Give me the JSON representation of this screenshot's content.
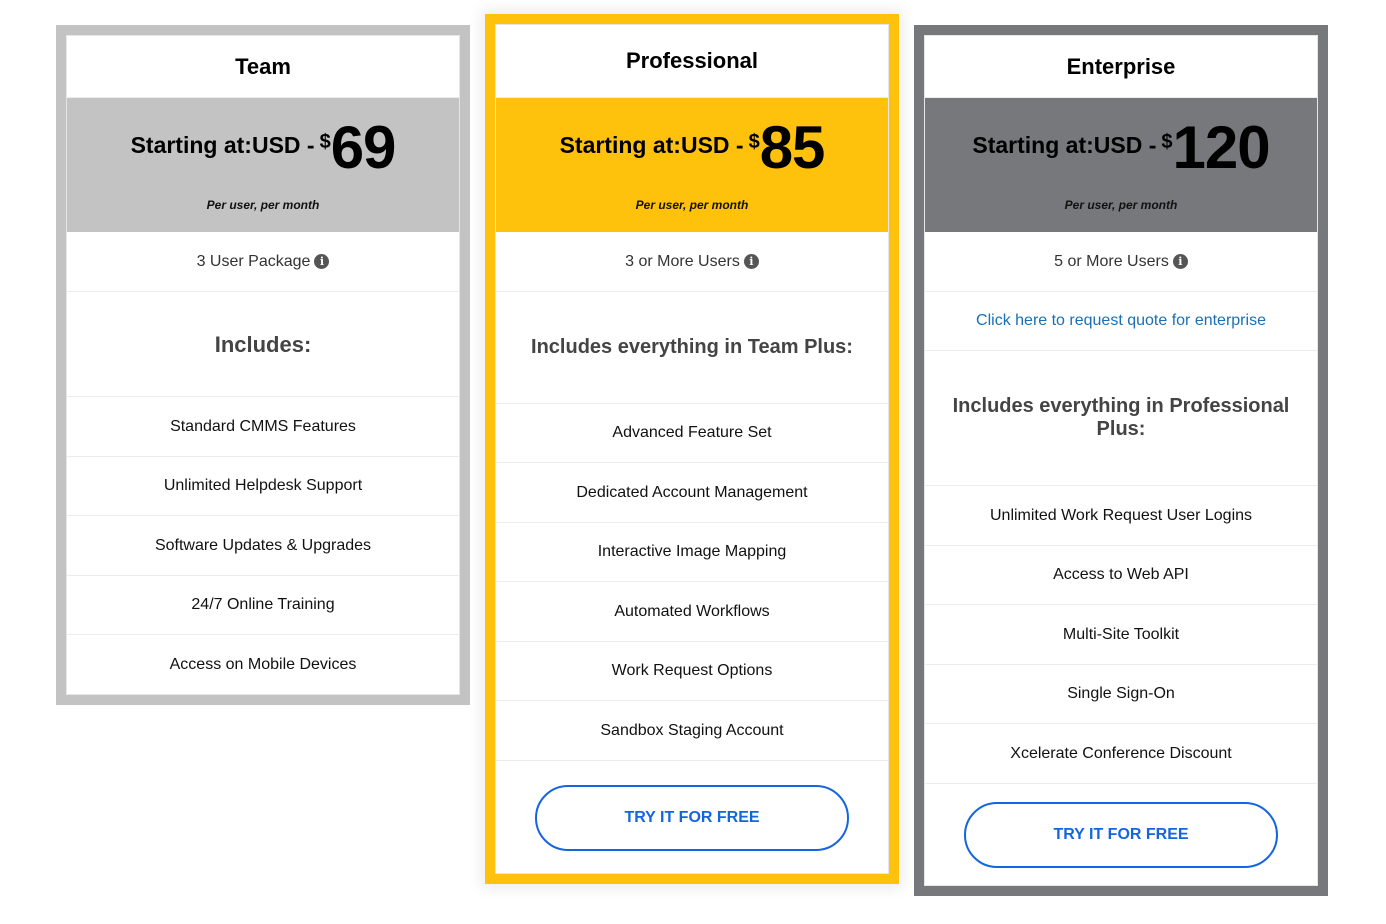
{
  "plans": [
    {
      "name": "Team",
      "price_prefix": "Starting at:USD - ",
      "currency_symbol": "$",
      "price": "69",
      "per_user": "Per user, per month",
      "users": "3 User Package",
      "includes_heading": "Includes:",
      "features": [
        "Standard CMMS Features",
        "Unlimited Helpdesk Support",
        "Software Updates & Upgrades",
        "24/7 Online Training",
        "Access on Mobile Devices"
      ],
      "color": "#c3c3c3"
    },
    {
      "name": "Professional",
      "price_prefix": "Starting at:USD - ",
      "currency_symbol": "$",
      "price": "85",
      "per_user": "Per user, per month",
      "users": "3 or More Users",
      "includes_heading": "Includes everything in Team Plus:",
      "features": [
        "Advanced Feature Set",
        "Dedicated Account Management",
        "Interactive Image Mapping",
        "Automated Workflows",
        "Work Request Options",
        "Sandbox Staging Account"
      ],
      "cta_label": "TRY IT FOR FREE",
      "color": "#fec20c"
    },
    {
      "name": "Enterprise",
      "price_prefix": "Starting at:USD - ",
      "currency_symbol": "$",
      "price": "120",
      "per_user": "Per user, per month",
      "users": "5 or More Users",
      "quote_link": "Click here to request quote for enterprise",
      "includes_heading": "Includes everything in Professional Plus:",
      "features": [
        "Unlimited Work Request User Logins",
        "Access to Web API",
        "Multi-Site Toolkit",
        "Single Sign-On",
        "Xcelerate Conference Discount"
      ],
      "cta_label": "TRY IT FOR FREE",
      "color": "#77787b"
    }
  ],
  "icons": {
    "info": "i"
  },
  "colors": {
    "cta_blue": "#1565e0",
    "link_blue": "#1a6fb5"
  }
}
